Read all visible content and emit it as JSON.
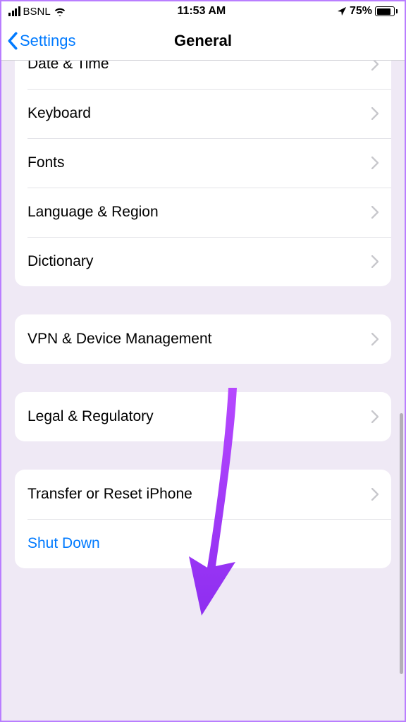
{
  "status": {
    "carrier": "BSNL",
    "time": "11:53 AM",
    "battery_pct": "75%"
  },
  "nav": {
    "back_label": "Settings",
    "title": "General"
  },
  "groups": [
    {
      "rows": [
        {
          "label": "Date & Time",
          "has_chevron": true
        },
        {
          "label": "Keyboard",
          "has_chevron": true
        },
        {
          "label": "Fonts",
          "has_chevron": true
        },
        {
          "label": "Language & Region",
          "has_chevron": true
        },
        {
          "label": "Dictionary",
          "has_chevron": true
        }
      ]
    },
    {
      "rows": [
        {
          "label": "VPN & Device Management",
          "has_chevron": true
        }
      ]
    },
    {
      "rows": [
        {
          "label": "Legal & Regulatory",
          "has_chevron": true
        }
      ]
    },
    {
      "rows": [
        {
          "label": "Transfer or Reset iPhone",
          "has_chevron": true
        },
        {
          "label": "Shut Down",
          "has_chevron": false,
          "blue": true
        }
      ]
    }
  ]
}
